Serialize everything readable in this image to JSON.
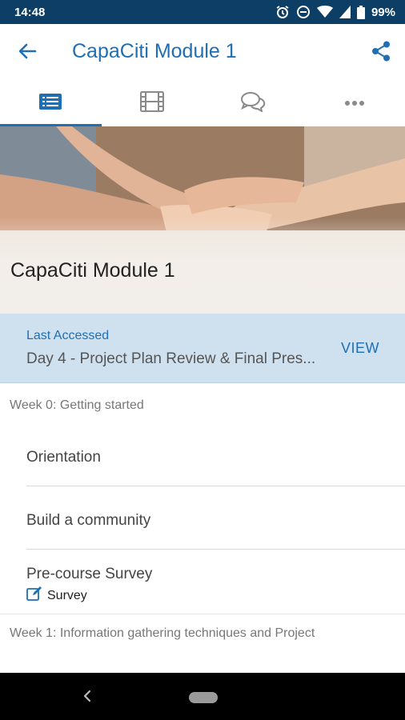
{
  "status_bar": {
    "time": "14:48",
    "battery": "99%"
  },
  "app_bar": {
    "title": "CapaCiti Module 1"
  },
  "tabs": [
    {
      "name": "outline",
      "icon": "list-icon",
      "active": true
    },
    {
      "name": "media",
      "icon": "film-icon",
      "active": false
    },
    {
      "name": "forum",
      "icon": "chat-icon",
      "active": false
    },
    {
      "name": "more",
      "icon": "more-icon",
      "active": false
    }
  ],
  "hero": {
    "title": "CapaCiti Module 1"
  },
  "last_accessed": {
    "label": "Last Accessed",
    "value": "Day 4 - Project Plan Review & Final Pres...",
    "action": "VIEW"
  },
  "sections": [
    {
      "header": "Week 0: Getting started",
      "items": [
        {
          "title": "Orientation"
        },
        {
          "title": "Build a community"
        },
        {
          "title": "Pre-course Survey",
          "type_icon": "edit-icon",
          "type_label": "Survey"
        }
      ]
    },
    {
      "header": "Week 1: Information gathering techniques and Project",
      "items": []
    }
  ],
  "colors": {
    "status_bar": "#0d3f66",
    "accent": "#1f6fb2",
    "last_accessed_bg": "#cfe1ef"
  }
}
